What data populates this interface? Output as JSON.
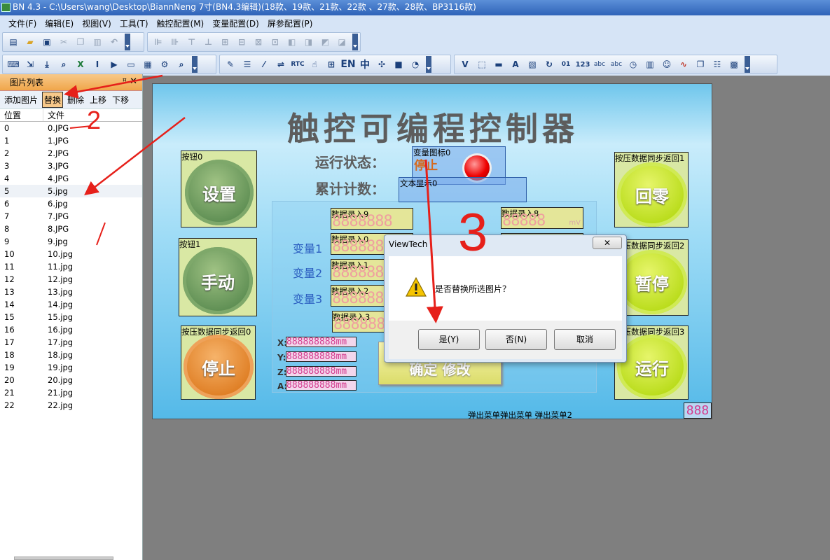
{
  "window": {
    "title": "BN 4.3 - C:\\Users\\wang\\Desktop\\BiannNeng 7寸(BN4.3编辑)(18款、19款、21款、22款 、27款、28款、BP3116款)"
  },
  "menu": [
    "文件(F)",
    "编辑(E)",
    "视图(V)",
    "工具(T)",
    "触控配置(M)",
    "变量配置(D)",
    "屏参配置(P)"
  ],
  "toolbar": {
    "rtc": "RTC",
    "en": "EN",
    "zh": "中",
    "num123": "123",
    "abc1": "abc",
    "abc2": "abc"
  },
  "panel": {
    "title": "图片列表",
    "pin": "ꟸ",
    "close": "✕",
    "tools": {
      "add": "添加图片",
      "replace": "替换",
      "delete": "删除",
      "up": "上移",
      "down": "下移"
    },
    "columns": {
      "pos": "位置",
      "file": "文件"
    },
    "rows": [
      {
        "pos": "0",
        "file": "0.JPG"
      },
      {
        "pos": "1",
        "file": "1.JPG"
      },
      {
        "pos": "2",
        "file": "2.JPG"
      },
      {
        "pos": "3",
        "file": "3.JPG"
      },
      {
        "pos": "4",
        "file": "4.JPG"
      },
      {
        "pos": "5",
        "file": "5.jpg"
      },
      {
        "pos": "6",
        "file": "6.jpg"
      },
      {
        "pos": "7",
        "file": "7.JPG"
      },
      {
        "pos": "8",
        "file": "8.JPG"
      },
      {
        "pos": "9",
        "file": "9.jpg"
      },
      {
        "pos": "10",
        "file": "10.jpg"
      },
      {
        "pos": "11",
        "file": "11.jpg"
      },
      {
        "pos": "12",
        "file": "12.jpg"
      },
      {
        "pos": "13",
        "file": "13.jpg"
      },
      {
        "pos": "14",
        "file": "14.jpg"
      },
      {
        "pos": "15",
        "file": "15.jpg"
      },
      {
        "pos": "16",
        "file": "16.jpg"
      },
      {
        "pos": "17",
        "file": "17.jpg"
      },
      {
        "pos": "18",
        "file": "18.jpg"
      },
      {
        "pos": "19",
        "file": "19.jpg"
      },
      {
        "pos": "20",
        "file": "20.jpg"
      },
      {
        "pos": "21",
        "file": "21.jpg"
      },
      {
        "pos": "22",
        "file": "22.jpg"
      }
    ]
  },
  "canvas": {
    "title": "触控可编程控制器",
    "run_status": "运行状态：",
    "count": "累计计数：",
    "var_icon_label": "变量图标0",
    "stop_text": "停止",
    "text_display": "文本显示0",
    "buttons": {
      "b0": {
        "label": "按钮0",
        "text": "设置"
      },
      "b1": {
        "label": "按钮1",
        "text": "手动"
      },
      "b2": {
        "label": "按压数据同步返回0",
        "text": "停止"
      },
      "r1": {
        "label": "按压数据同步返回1",
        "text": "回零"
      },
      "r2": {
        "label": "按压数据同步返回2",
        "text": "暂停"
      },
      "r3": {
        "label": "按压数据同步返回3",
        "text": "运行"
      }
    },
    "vars": [
      "变量1",
      "变量2",
      "变量3"
    ],
    "entries": {
      "e9": "数据录入9",
      "e0": "数据录入0",
      "e1": "数据录入1",
      "e2": "数据录入2",
      "e3": "数据录入3",
      "e8": "数据录入8",
      "e8unit": "mV"
    },
    "digits": "8888888",
    "digits8": "88888",
    "xyz": [
      {
        "label": "X:",
        "value": "888888888mm"
      },
      {
        "label": "Y:",
        "value": "888888888mm"
      },
      {
        "label": "Z:",
        "value": "888888888mm"
      },
      {
        "label": "A:",
        "value": "888888888mm"
      }
    ],
    "confirm": "确定 修改",
    "menus": [
      "弹出菜单",
      "弹出菜单",
      "弹出菜单2"
    ],
    "corner": "888"
  },
  "dialog": {
    "title": "ViewTech",
    "message": "是否替换所选图片？",
    "yes": "是(Y)",
    "no": "否(N)",
    "cancel": "取消",
    "close": "✕"
  },
  "annotations": {
    "n2": "2",
    "n3": "3"
  }
}
